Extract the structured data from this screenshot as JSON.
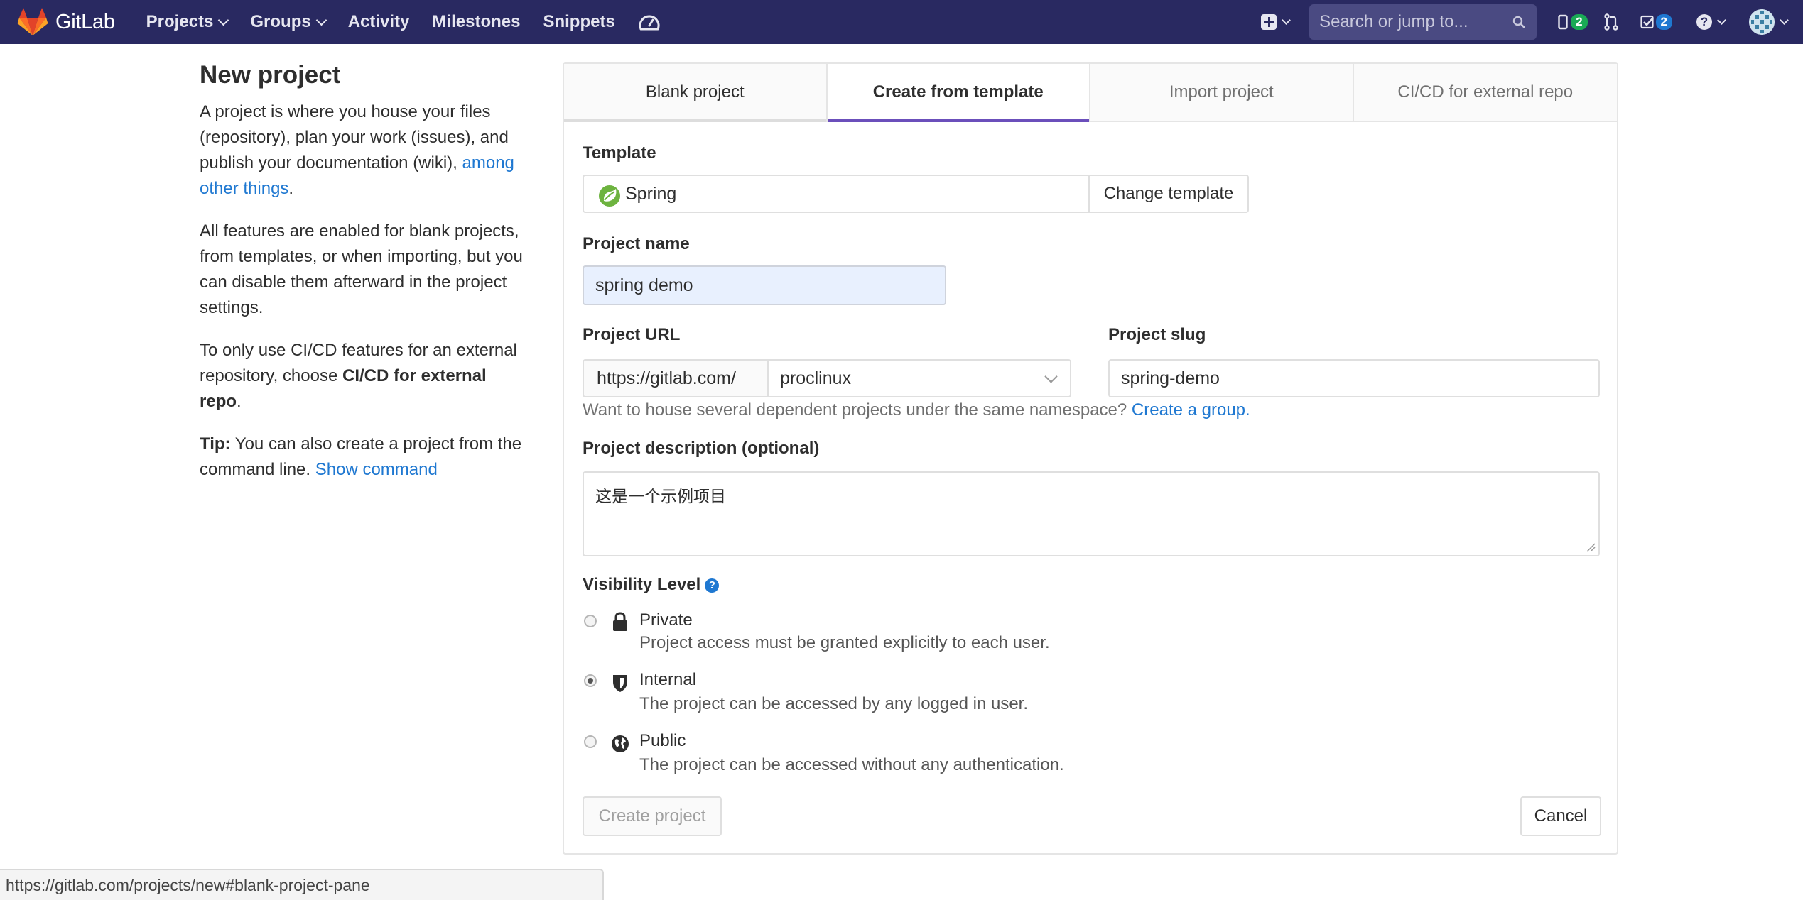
{
  "navbar": {
    "brand": "GitLab",
    "links": [
      {
        "label": "Projects",
        "dropdown": true
      },
      {
        "label": "Groups",
        "dropdown": true
      },
      {
        "label": "Activity",
        "dropdown": false
      },
      {
        "label": "Milestones",
        "dropdown": false
      },
      {
        "label": "Snippets",
        "dropdown": false
      }
    ],
    "search_placeholder": "Search or jump to...",
    "issues_count": "2",
    "todos_count": "2",
    "help_glyph": "?"
  },
  "intro": {
    "title": "New project",
    "p1_text": "A project is where you house your files (repository), plan your work (issues), and publish your documentation (wiki), ",
    "p1_link": "among other things",
    "p1_end": ".",
    "p2": "All features are enabled for blank projects, from templates, or when importing, but you can disable them afterward in the project settings.",
    "p3_text": "To only use CI/CD features for an external repository, choose ",
    "p3_bold": "CI/CD for external repo",
    "p3_end": ".",
    "tip_label": "Tip:",
    "tip_text": " You can also create a project from the command line. ",
    "tip_link": "Show command"
  },
  "tabs": [
    {
      "label": "Blank project"
    },
    {
      "label": "Create from template"
    },
    {
      "label": "Import project"
    },
    {
      "label": "CI/CD for external repo"
    }
  ],
  "form": {
    "template_label": "Template",
    "template_value": "Spring",
    "change_template": "Change template",
    "name_label": "Project name",
    "name_value": "spring demo",
    "url_label": "Project URL",
    "url_prefix": "https://gitlab.com/",
    "namespace": "proclinux",
    "slug_label": "Project slug",
    "slug_value": "spring-demo",
    "group_hint": "Want to house several dependent projects under the same namespace? ",
    "group_link": "Create a group.",
    "desc_label": "Project description (optional)",
    "desc_value": "这是一个示例项目",
    "visibility_label": "Visibility Level",
    "visibility": [
      {
        "title": "Private",
        "desc": "Project access must be granted explicitly to each user.",
        "checked": false,
        "icon": "lock-icon"
      },
      {
        "title": "Internal",
        "desc": "The project can be accessed by any logged in user.",
        "checked": true,
        "icon": "shield-icon"
      },
      {
        "title": "Public",
        "desc": "The project can be accessed without any authentication.",
        "checked": false,
        "icon": "globe-icon"
      }
    ],
    "create_button": "Create project",
    "cancel_button": "Cancel"
  },
  "status_url": "https://gitlab.com/projects/new#blank-project-pane",
  "colors": {
    "navbar": "#292961",
    "link": "#1f78d1",
    "active_tab": "#6b4fbb",
    "badge_green": "#1aaa55",
    "badge_blue": "#1f78d1"
  }
}
